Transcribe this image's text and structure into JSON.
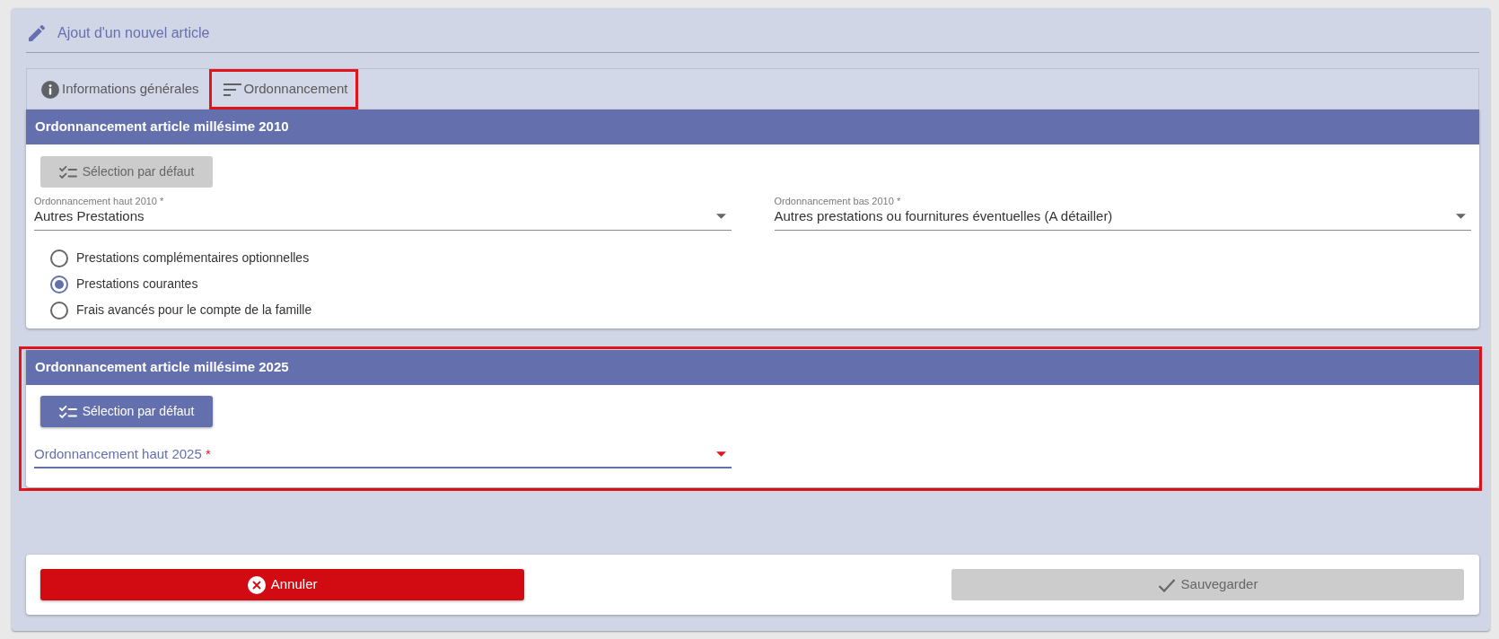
{
  "header": {
    "title": "Ajout d'un nouvel article"
  },
  "tabs": [
    {
      "kind": "general",
      "label": "Informations générales",
      "selected": false
    },
    {
      "kind": "ordering",
      "label": "Ordonnancement",
      "selected": true
    }
  ],
  "panels": [
    {
      "title": "Ordonnancement article millésime 2010",
      "highlighted": false,
      "default_button": {
        "label": "Sélection par défaut",
        "disabled": true
      },
      "fields": [
        {
          "label": "Ordonnancement haut 2010",
          "required_mark": "*",
          "value": "Autres Prestations",
          "focused": false,
          "invalid": false
        },
        {
          "label": "Ordonnancement bas 2010",
          "required_mark": "*",
          "value": "Autres prestations ou fournitures éventuelles (A détailler)",
          "focused": false,
          "invalid": false
        }
      ],
      "options": [
        {
          "label": "Prestations complémentaires optionnelles",
          "selected": false
        },
        {
          "label": "Prestations courantes",
          "selected": true
        },
        {
          "label": "Frais avancés pour le compte de la famille",
          "selected": false
        }
      ]
    },
    {
      "title": "Ordonnancement article millésime 2025",
      "highlighted": true,
      "default_button": {
        "label": "Sélection par défaut",
        "disabled": false
      },
      "fields": [
        {
          "label": "Ordonnancement haut 2025",
          "required_mark": "*",
          "focused": true,
          "invalid": true
        }
      ]
    }
  ],
  "actions": [
    {
      "kind": "cancel",
      "label": "Annuler",
      "disabled": false
    },
    {
      "kind": "save",
      "label": "Sauvegarder",
      "disabled": true
    }
  ]
}
